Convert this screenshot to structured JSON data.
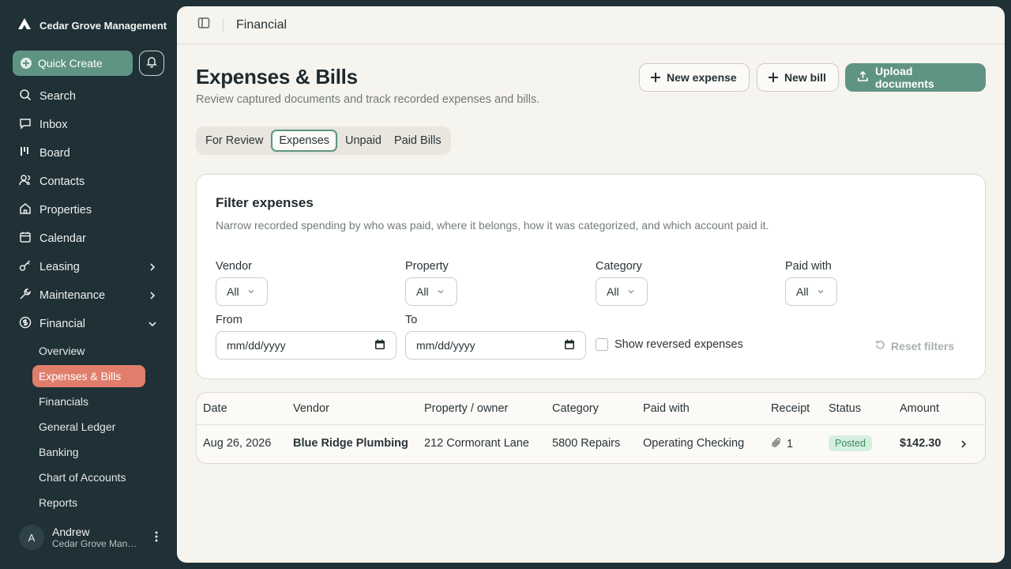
{
  "app": {
    "org_name": "Cedar Grove Management"
  },
  "sidebar": {
    "quick_create": "Quick Create",
    "items": [
      {
        "label": "Search",
        "icon": "search-icon"
      },
      {
        "label": "Inbox",
        "icon": "inbox-icon"
      },
      {
        "label": "Board",
        "icon": "board-icon"
      },
      {
        "label": "Contacts",
        "icon": "contacts-icon"
      },
      {
        "label": "Properties",
        "icon": "home-icon"
      },
      {
        "label": "Calendar",
        "icon": "calendar-icon"
      },
      {
        "label": "Leasing",
        "icon": "key-icon"
      },
      {
        "label": "Maintenance",
        "icon": "wrench-icon"
      },
      {
        "label": "Financial",
        "icon": "dollar-icon"
      }
    ],
    "financial_sub": [
      {
        "label": "Overview"
      },
      {
        "label": "Expenses & Bills",
        "active": true
      },
      {
        "label": "Financials"
      },
      {
        "label": "General Ledger"
      },
      {
        "label": "Banking"
      },
      {
        "label": "Chart of Accounts"
      },
      {
        "label": "Reports"
      }
    ],
    "user": {
      "initial": "A",
      "name": "Andrew",
      "org": "Cedar Grove Management"
    }
  },
  "topbar": {
    "breadcrumb": "Financial"
  },
  "page": {
    "title": "Expenses & Bills",
    "subtitle": "Review captured documents and track recorded expenses and bills.",
    "new_expense": "New expense",
    "new_bill": "New bill",
    "upload": "Upload documents"
  },
  "tabs": [
    "For Review",
    "Expenses",
    "Unpaid",
    "Paid Bills"
  ],
  "active_tab": "Expenses",
  "filters": {
    "title": "Filter expenses",
    "description": "Narrow recorded spending by who was paid, where it belongs, how it was categorized, and which account paid it.",
    "vendor_label": "Vendor",
    "vendor_value": "All",
    "property_label": "Property",
    "property_value": "All",
    "category_label": "Category",
    "category_value": "All",
    "paid_with_label": "Paid with",
    "paid_with_value": "All",
    "from_label": "From",
    "from_placeholder": "mm/dd/yyyy",
    "to_label": "To",
    "to_placeholder": "mm/dd/yyyy",
    "show_reversed": "Show reversed expenses",
    "reset": "Reset filters"
  },
  "table": {
    "columns": [
      "Date",
      "Vendor",
      "Property / owner",
      "Category",
      "Paid with",
      "Receipt",
      "Status",
      "Amount"
    ],
    "rows": [
      {
        "date": "Aug 26, 2026",
        "vendor": "Blue Ridge Plumbing",
        "property": "212 Cormorant Lane",
        "category": "5800 Repairs",
        "paid_with": "Operating Checking",
        "receipt": "1",
        "status": "Posted",
        "amount": "$142.30"
      }
    ]
  },
  "colors": {
    "sidebar_bg": "#1f3036",
    "accent": "#5f9484",
    "active_nav": "#e07e6b",
    "status_posted_bg": "#d5efdf"
  }
}
